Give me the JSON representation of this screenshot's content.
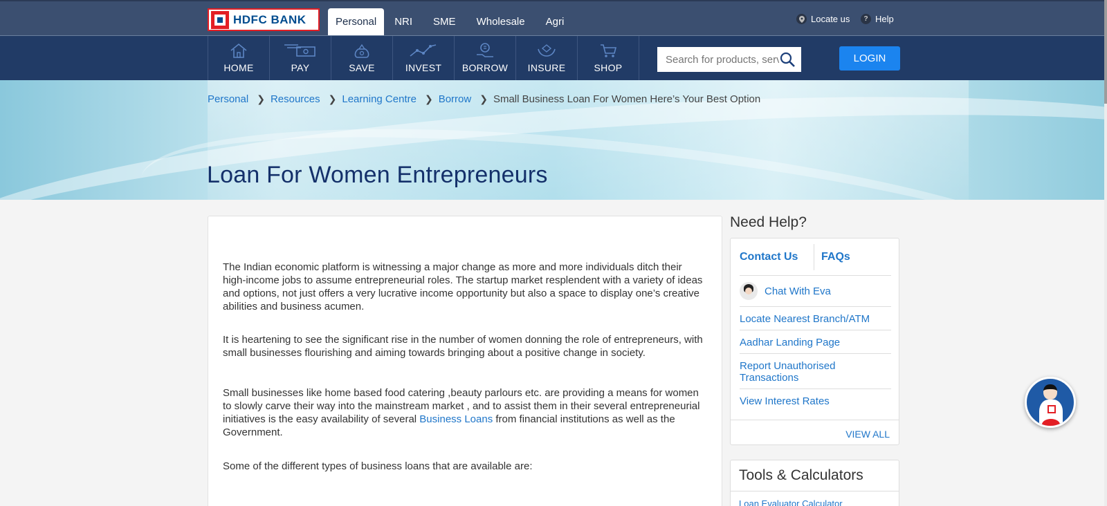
{
  "header": {
    "logo_text": "HDFC BANK",
    "segments": [
      {
        "label": "Personal",
        "active": true
      },
      {
        "label": "NRI"
      },
      {
        "label": "SME"
      },
      {
        "label": "Wholesale"
      },
      {
        "label": "Agri"
      }
    ],
    "locate_label": "Locate us",
    "help_label": "Help"
  },
  "nav": {
    "items": [
      {
        "label": "HOME",
        "icon": "home-icon"
      },
      {
        "label": "PAY",
        "icon": "pay-icon"
      },
      {
        "label": "SAVE",
        "icon": "save-icon"
      },
      {
        "label": "INVEST",
        "icon": "invest-icon"
      },
      {
        "label": "BORROW",
        "icon": "borrow-icon"
      },
      {
        "label": "INSURE",
        "icon": "insure-icon"
      },
      {
        "label": "SHOP",
        "icon": "shop-icon"
      }
    ],
    "search_placeholder": "Search for products, servi...",
    "login_label": "LOGIN"
  },
  "breadcrumb": [
    {
      "label": "Personal"
    },
    {
      "label": "Resources"
    },
    {
      "label": "Learning Centre"
    },
    {
      "label": "Borrow"
    },
    {
      "label": "Small Business Loan For Women Here’s Your Best Option"
    }
  ],
  "page": {
    "title": "Loan For Women Entrepreneurs"
  },
  "article": {
    "p1": "The Indian economic platform is witnessing a major change as more and more individuals ditch their high-income jobs to assume entrepreneurial roles. The startup market resplendent with a variety of ideas and options, not just offers a very lucrative income opportunity but also a space to display one’s creative abilities and business acumen.",
    "p2": "It is heartening to see the significant rise in the number of women donning the role of entrepreneurs, with small businesses flourishing and aiming towards bringing about a positive change in society.",
    "p3_before": "Small businesses like home based food catering ,beauty parlours etc. are providing a means for women to slowly carve their way into the mainstream market , and to assist them in their several entrepreneurial initiatives is the easy availability of several ",
    "p3_link": "Business Loans",
    "p3_after": " from financial institutions as well as the Government.",
    "p4": "Some of the different types of business loans that are available are:"
  },
  "sidebar": {
    "help_title": "Need Help?",
    "tabs": [
      "Contact Us",
      "FAQs"
    ],
    "chat_label": "Chat With Eva",
    "links": [
      "Locate Nearest Branch/ATM",
      "Aadhar Landing Page",
      "Report Unauthorised Transactions",
      "View Interest Rates"
    ],
    "view_all": "VIEW ALL",
    "tools_title": "Tools & Calculators",
    "tools_link": "Loan Evaluator Calculator"
  },
  "colors": {
    "topbar": "#3b4f70",
    "navbar": "#213b66",
    "link": "#1f76c9",
    "login": "#1b84ef",
    "brand_red": "#e31e24",
    "title": "#14306a"
  }
}
